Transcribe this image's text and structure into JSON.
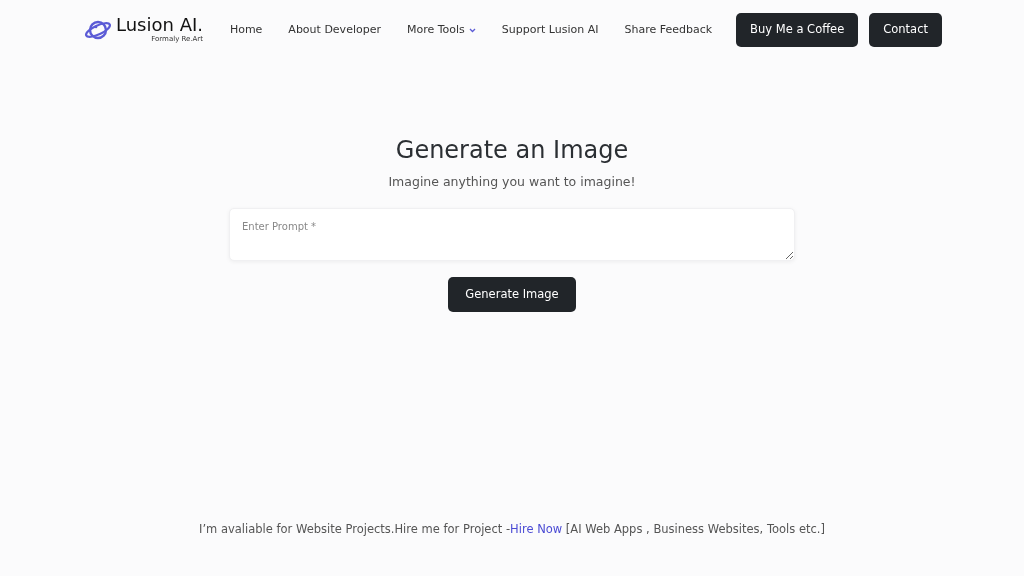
{
  "brand": {
    "name": "Lusion AI.",
    "tagline": "Formaly Re.Art"
  },
  "nav": [
    {
      "kind": "link",
      "label": "Home"
    },
    {
      "kind": "link",
      "label": "About Developer"
    },
    {
      "kind": "dropdown",
      "label": "More Tools"
    },
    {
      "kind": "link",
      "label": "Support Lusion AI"
    },
    {
      "kind": "link",
      "label": "Share Feedback"
    },
    {
      "kind": "button",
      "label": "Buy Me a Coffee"
    },
    {
      "kind": "button",
      "label": "Contact"
    }
  ],
  "main": {
    "title": "Generate an Image",
    "subtitle": "Imagine anything you want to imagine!",
    "prompt": {
      "placeholder": "Enter Prompt *"
    },
    "button": "Generate Image"
  },
  "footer": {
    "before": "I’m avaliable for Website Projects.Hire me for Project -",
    "link": "Hire Now",
    "after": " [AI Web Apps , Business Websites, Tools etc.]"
  }
}
